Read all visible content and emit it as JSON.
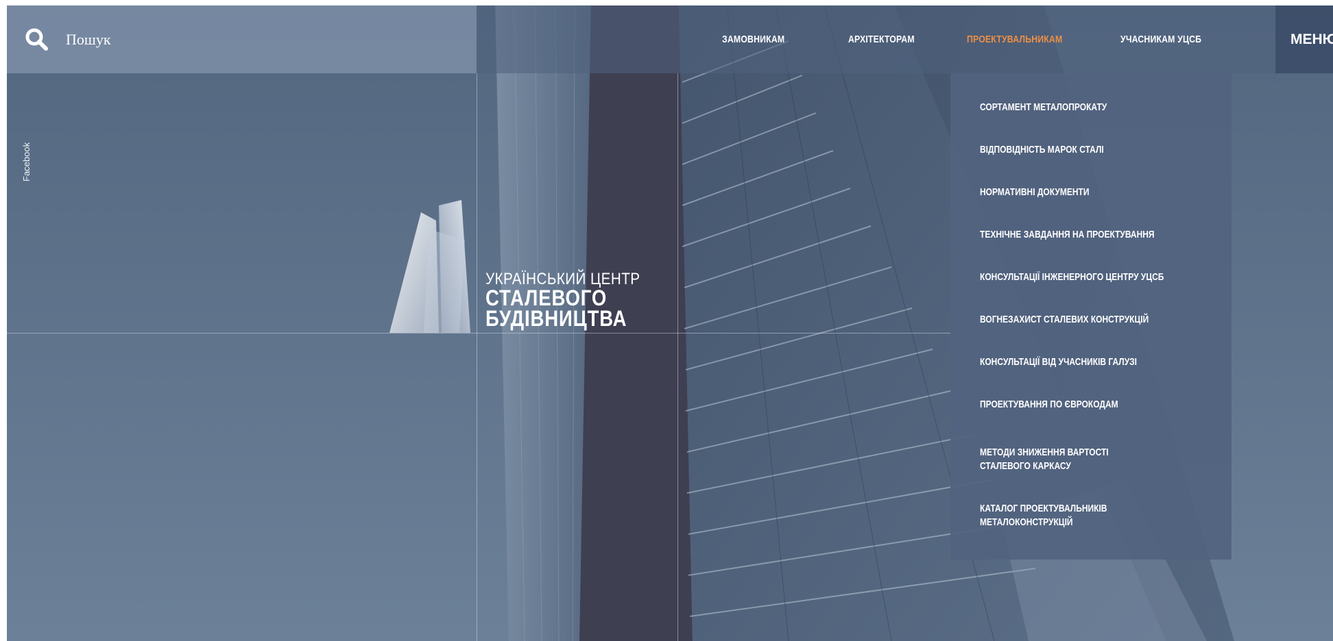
{
  "search": {
    "label": "Пошук",
    "icon": "search-icon"
  },
  "nav": {
    "items": [
      {
        "label": "ЗАМОВНИКАМ",
        "active": false
      },
      {
        "label": "АРХІТЕКТОРАМ",
        "active": false
      },
      {
        "label": "ПРОЕКТУВАЛЬНИКАМ",
        "active": true
      },
      {
        "label": "УЧАСНИКАМ УЦСБ",
        "active": false
      }
    ],
    "menu_label": "МЕНЮ",
    "active_color": "#ec8f45"
  },
  "social": {
    "facebook": "Facebook"
  },
  "logo": {
    "line1": "УКРАЇНСЬКИЙ ЦЕНТР",
    "line2": "СТАЛЕВОГО",
    "line3": "БУДІВНИЦТВА"
  },
  "dropdown": {
    "items": [
      "СОРТАМЕНТ МЕТАЛОПРОКАТУ",
      "ВІДПОВІДНІСТЬ МАРОК СТАЛІ",
      "НОРМАТИВНІ ДОКУМЕНТИ",
      "ТЕХНІЧНЕ ЗАВДАННЯ НА ПРОЕКТУВАННЯ",
      "КОНСУЛЬТАЦІЇ ІНЖЕНЕРНОГО ЦЕНТРУ УЦСБ",
      "ВОГНЕЗАХИСТ СТАЛЕВИХ КОНСТРУКЦІЙ",
      "КОНСУЛЬТАЦІЇ ВІД УЧАСНИКІВ ГАЛУЗІ",
      "ПРОЕКТУВАННЯ ПО ЄВРОКОДАМ",
      "МЕТОДИ ЗНИЖЕННЯ ВАРТОСТІ СТАЛЕВОГО КАРКАСУ",
      "КАТАЛОГ ПРОЕКТУВАЛЬНИКІВ МЕТАЛОКОНСТРУКЦІЙ"
    ]
  }
}
